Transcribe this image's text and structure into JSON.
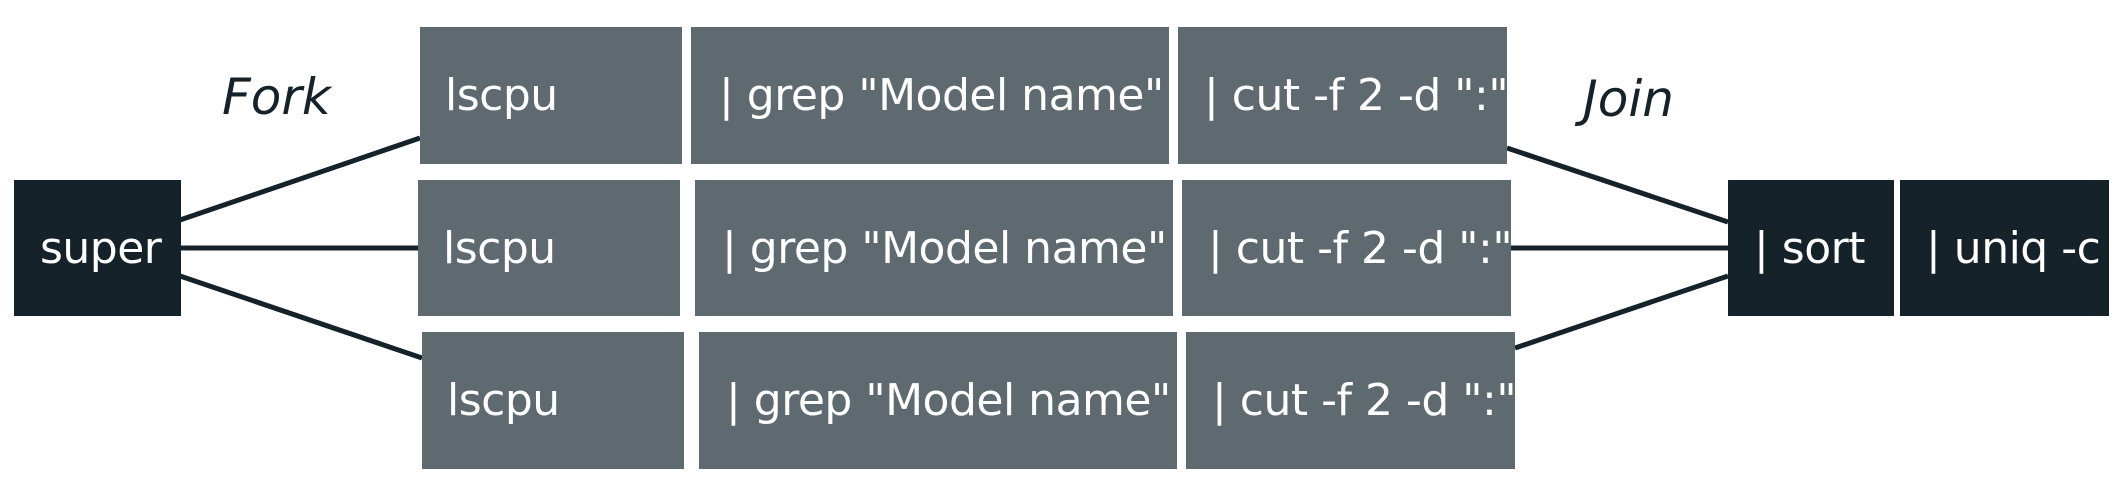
{
  "labels": {
    "fork": "Fork",
    "join": "Join"
  },
  "source": {
    "label": "super"
  },
  "pipelines": [
    {
      "stages": [
        "lscpu",
        "| grep \"Model name\"",
        "| cut -f 2 -d \":\""
      ]
    },
    {
      "stages": [
        "lscpu",
        "| grep \"Model name\"",
        "| cut -f 2 -d \":\""
      ]
    },
    {
      "stages": [
        "lscpu",
        "| grep \"Model name\"",
        "| cut -f 2 -d \":\""
      ]
    }
  ],
  "sink": {
    "stages": [
      "| sort",
      "| uniq -c"
    ]
  },
  "colors": {
    "stage": "#5f6970",
    "dark": "#16222a",
    "line": "#16222a"
  }
}
